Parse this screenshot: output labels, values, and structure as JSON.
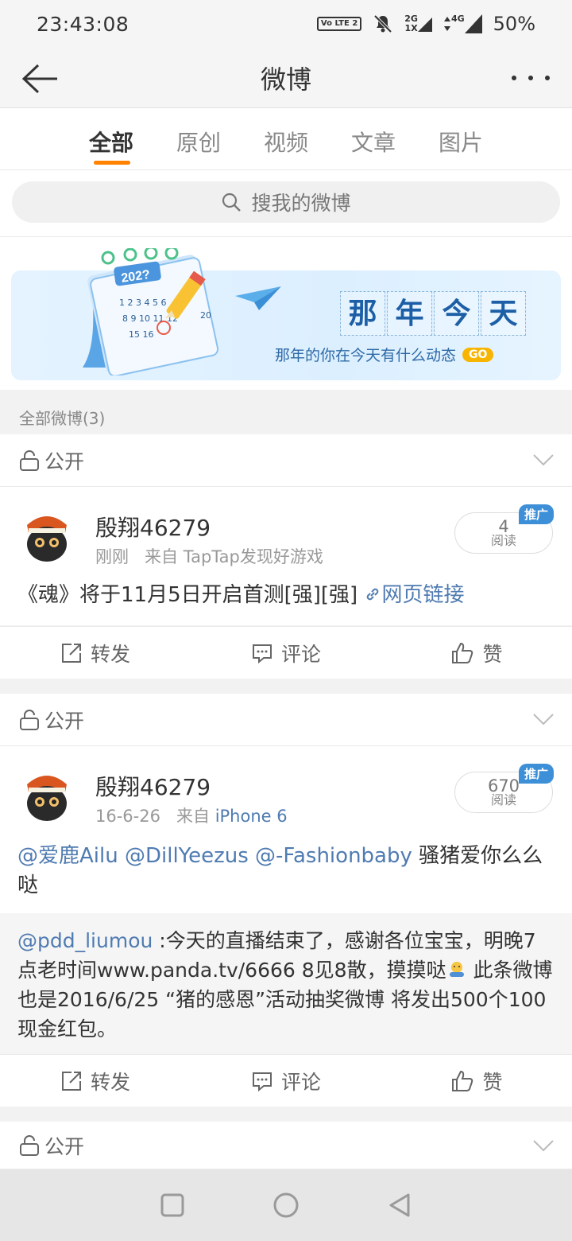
{
  "status_bar": {
    "time": "23:43:08",
    "volte": "Vo LTE 2",
    "net_2g": "2G",
    "net_1x": "1X",
    "net_4g": "4G",
    "battery": "50%"
  },
  "nav": {
    "title": "微博"
  },
  "tabs": [
    {
      "label": "全部",
      "active": true
    },
    {
      "label": "原创",
      "active": false
    },
    {
      "label": "视频",
      "active": false
    },
    {
      "label": "文章",
      "active": false
    },
    {
      "label": "图片",
      "active": false
    }
  ],
  "search": {
    "placeholder": "搜我的微博"
  },
  "banner": {
    "calendar_year": "202?",
    "title_chars": [
      "那",
      "年",
      "今",
      "天"
    ],
    "subtitle": "那年的你在今天有什么动态",
    "go": "GO"
  },
  "section_label": "全部微博(3)",
  "visibility_label": "公开",
  "posts": [
    {
      "author": "殷翔46279",
      "time": "刚刚",
      "source_prefix": "来自",
      "source": "TapTap发现好游戏",
      "reads": "4",
      "reads_label": "阅读",
      "ad_badge": "推广",
      "text": "《魂》将于11月5日开启首测[强][强]",
      "link_text": "网页链接"
    },
    {
      "author": "殷翔46279",
      "time": "16-6-26",
      "source_prefix": "来自",
      "source": "iPhone 6",
      "reads": "670",
      "reads_label": "阅读",
      "ad_badge": "推广",
      "mentions": "@爱鹿Ailu @DillYeezus @-Fashionbaby",
      "text": "骚猪爱你么么哒",
      "repost_mention": "@pdd_liumou",
      "repost_text_1": ":今天的直播结束了，感谢各位宝宝，明晚7点老时间www.panda.tv/6666 8见8散，摸摸哒",
      "repost_text_2": " 此条微博也是2016/6/25 “猪的感恩”活动抽奖微博 将发出500个100现金红包。"
    }
  ],
  "actions": {
    "repost": "转发",
    "comment": "评论",
    "like": "赞"
  },
  "colors": {
    "accent": "#ff8200",
    "link": "#4f7bb1",
    "ad_badge": "#3d8fd8"
  }
}
